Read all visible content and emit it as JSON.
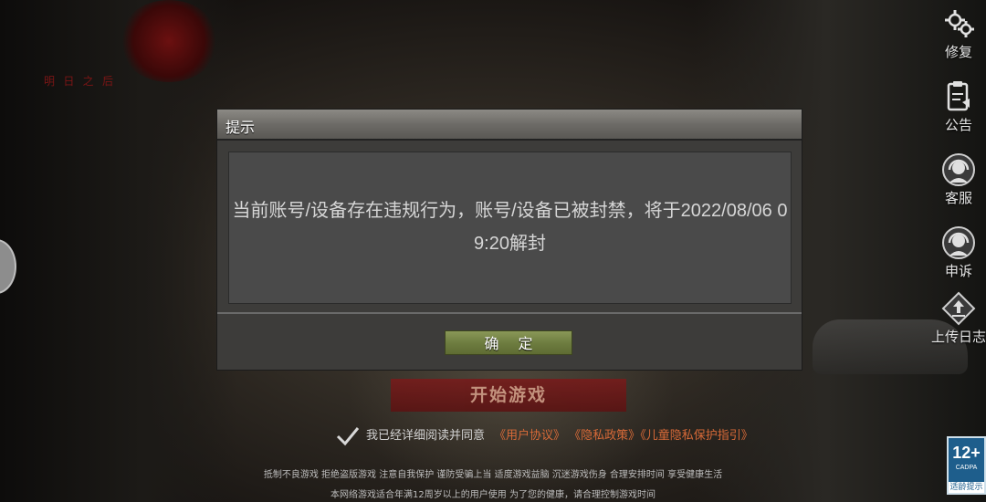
{
  "logo": {
    "subtitle": "明 日 之 后"
  },
  "side_menu": {
    "items": [
      {
        "label": "修复",
        "icon": "gear-icon"
      },
      {
        "label": "公告",
        "icon": "announcement-icon"
      },
      {
        "label": "客服",
        "icon": "customer-service-icon"
      },
      {
        "label": "申诉",
        "icon": "appeal-icon"
      },
      {
        "label": "上传日志",
        "icon": "upload-log-icon"
      }
    ]
  },
  "dialog": {
    "title": "提示",
    "message": "当前账号/设备存在违规行为，账号/设备已被封禁，将于2022/08/06 09:20解封",
    "confirm_label": "确 定"
  },
  "start_button": {
    "label": "开始游戏"
  },
  "agreement": {
    "checked": true,
    "text": "我已经详细阅读并同意",
    "links": [
      "《用户协议》",
      "《隐私政策》",
      "《儿童隐私保护指引》"
    ]
  },
  "notices": {
    "line1": "抵制不良游戏 拒绝盗版游戏 注意自我保护 谨防受骗上当 适度游戏益脑 沉迷游戏伤身 合理安排时间 享受健康生活",
    "line2": "本网络游戏适合年满12周岁以上的用户使用    为了您的健康，请合理控制游戏时间"
  },
  "age_rating": {
    "value": "12+",
    "org": "CADPA",
    "tip": "适龄提示"
  },
  "colors": {
    "accent_link": "#d86a38",
    "confirm_green": "#6e7d40",
    "start_red": "#7a1a1a",
    "age_blue": "#1e5e8c"
  }
}
